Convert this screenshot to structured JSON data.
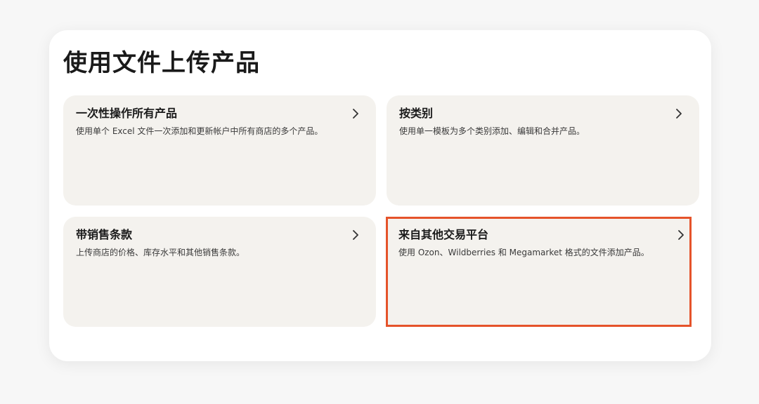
{
  "page": {
    "title": "使用文件上传产品"
  },
  "cards": [
    {
      "title": "一次性操作所有产品",
      "description": "使用单个 Excel 文件一次添加和更新帐户中所有商店的多个产品。",
      "icon": "chevron-right-icon"
    },
    {
      "title": "按类别",
      "description": "使用单一模板为多个类别添加、编辑和合并产品。",
      "icon": "chevron-right-icon"
    },
    {
      "title": "带销售条款",
      "description": "上传商店的价格、库存水平和其他销售条款。",
      "icon": "chevron-right-icon"
    },
    {
      "title": "来自其他交易平台",
      "description": "使用 Ozon、Wildberries 和 Megamarket 格式的文件添加产品。",
      "icon": "chevron-right-icon"
    }
  ],
  "colors": {
    "highlight_border": "#e5532a",
    "card_background": "#f4f2ee",
    "panel_background": "#ffffff"
  }
}
